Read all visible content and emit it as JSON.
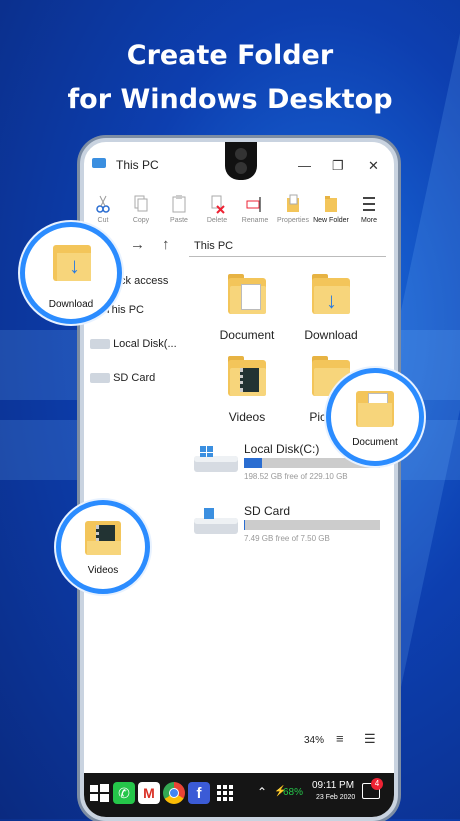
{
  "headline": {
    "line1": "Create Folder",
    "line2": "for Windows Desktop"
  },
  "window": {
    "title": "This PC"
  },
  "toolbar": {
    "items": [
      {
        "label": "Cut",
        "icon": "scissors-icon"
      },
      {
        "label": "Copy",
        "icon": "copy-icon"
      },
      {
        "label": "Paste",
        "icon": "paste-icon"
      },
      {
        "label": "Delete",
        "icon": "delete-icon"
      },
      {
        "label": "Rename",
        "icon": "rename-icon"
      },
      {
        "label": "Properties",
        "icon": "properties-icon"
      },
      {
        "label": "New Folder",
        "icon": "new-folder-icon"
      },
      {
        "label": "More",
        "icon": "more-icon"
      }
    ]
  },
  "address": {
    "path": "This PC"
  },
  "sidebar": {
    "items": [
      {
        "label": "Quick access"
      },
      {
        "label": "This PC"
      },
      {
        "label": "Local Disk(...",
        "icon": "drive-icon"
      },
      {
        "label": "SD Card",
        "icon": "drive-icon"
      }
    ]
  },
  "folders": [
    {
      "label": "Document",
      "icon": "document-folder-icon"
    },
    {
      "label": "Download",
      "icon": "download-folder-icon"
    },
    {
      "label": "Videos",
      "icon": "videos-folder-icon"
    },
    {
      "label": "Pictures",
      "icon": "pictures-folder-icon"
    }
  ],
  "drives": [
    {
      "name": "Local Disk(C:)",
      "free": "198.52 GB free of 229.10 GB",
      "used_fraction": 0.133,
      "bar_color": "#2a6dd1"
    },
    {
      "name": "SD Card",
      "free": "7.49 GB free of 7.50 GB",
      "used_fraction": 0.0013,
      "bar_color": "#2a6dd1"
    }
  ],
  "status": {
    "zoom": "34%"
  },
  "taskbar": {
    "battery": "68%",
    "time": "09:11 PM",
    "date": "23 Feb 2020",
    "notification_count": "4",
    "apps": [
      "windows-start-icon",
      "phone-icon",
      "gmail-icon",
      "chrome-icon",
      "facebook-icon",
      "apps-grid-icon"
    ]
  },
  "callouts": {
    "download": "Download",
    "document": "Document",
    "videos": "Videos"
  }
}
